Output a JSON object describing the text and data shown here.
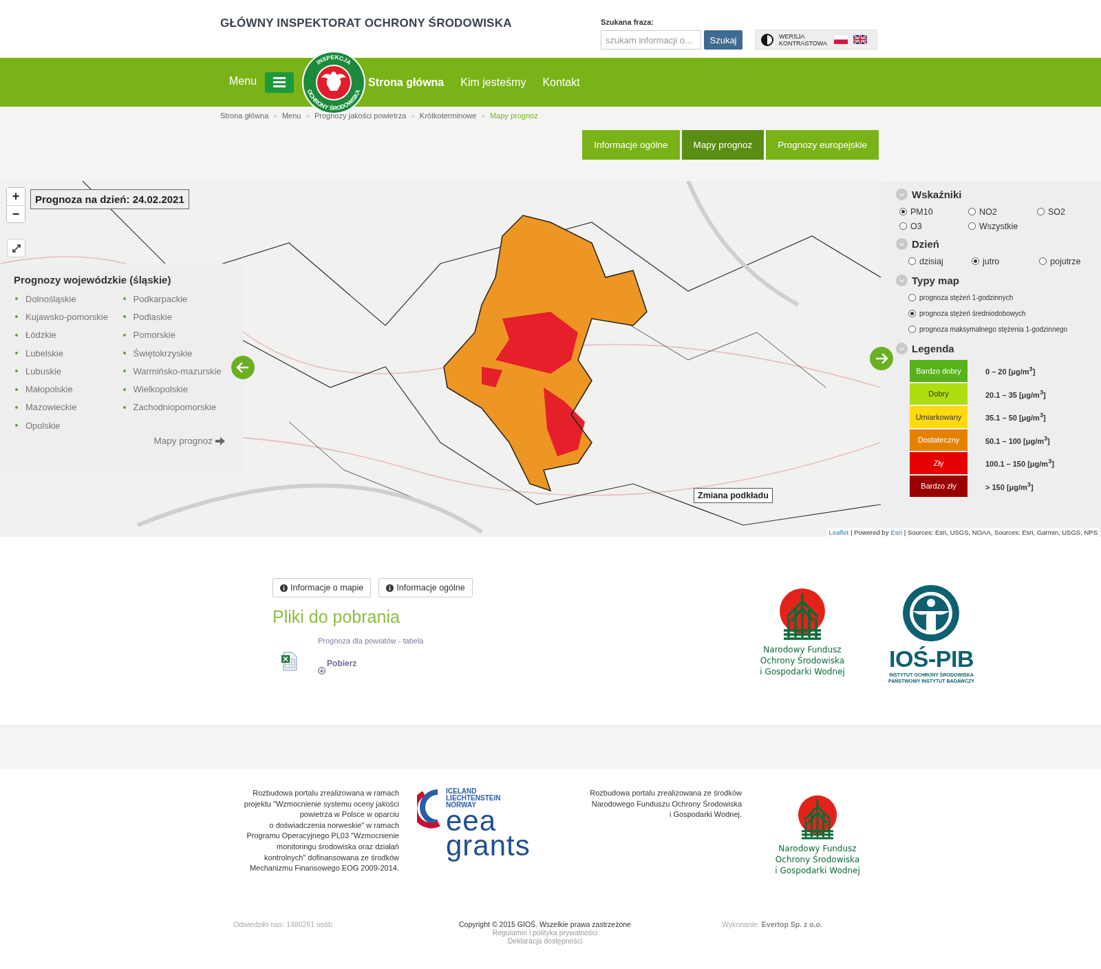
{
  "header": {
    "title": "GŁÓWNY INSPEKTORAT OCHRONY ŚRODOWISKA",
    "search_label": "Szukana fraza:",
    "search": {
      "placeholder": "szukam informacji o..."
    },
    "search_button": "Szukaj",
    "contrast_label": "WERSJA KONTRASTOWA"
  },
  "nav": {
    "menu_label": "Menu",
    "logo_top": "INSPEKCJA",
    "logo_bottom": "OCHRONY ŚRODOWISKA",
    "items": [
      {
        "label": "Strona główna",
        "selected": true
      },
      {
        "label": "Kim jesteśmy",
        "selected": false
      },
      {
        "label": "Kontakt",
        "selected": false
      }
    ]
  },
  "breadcrumb": {
    "separator": "»",
    "items": [
      {
        "label": "Strona główna",
        "current": false
      },
      {
        "label": "Menu",
        "current": false
      },
      {
        "label": "Prognozy jakości powietrza",
        "current": false
      },
      {
        "label": "Krótkoterminowe",
        "current": false
      },
      {
        "label": "Mapy prognoz",
        "current": true
      }
    ]
  },
  "tabs": [
    {
      "label": "Informacje ogólne",
      "selected": false
    },
    {
      "label": "Mapy prognoz",
      "selected": true
    },
    {
      "label": "Prognozy europejskie",
      "selected": false
    }
  ],
  "map": {
    "zoom_in": "+",
    "zoom_out": "−",
    "forecast_label": "Prognoza na dzień: 24.02.2021",
    "basemap_button": "Zmiana podkładu",
    "attribution": [
      {
        "text": "Leaflet",
        "link": true
      },
      {
        "text": "| Powered by",
        "link": false
      },
      {
        "text": "Esri",
        "link": true
      },
      {
        "text": "| Sources: Esri, USGS, NOAA, Sources: Esri, Garmin, USGS, NPS",
        "link": false
      }
    ]
  },
  "voivodeship_panel": {
    "title": "Prognozy wojewódzkie (śląskie)",
    "items": [
      "Dolnośląskie",
      "Kujawsko-pomorskie",
      "Łódzkie",
      "Lubelskie",
      "Lubuskie",
      "Małopolskie",
      "Mazowieckie",
      "Opolskie",
      "Podkarpackie",
      "Podlaskie",
      "Pomorskie",
      "Świętokrzyskie",
      "Warmińsko-mazurskie",
      "Wielkopolskie",
      "Zachodniopomorskie"
    ],
    "more_link": "Mapy prognoz"
  },
  "controls": [
    {
      "title": "Wskaźniki",
      "kind": "grid",
      "options": [
        {
          "label": "PM10",
          "selected": true
        },
        {
          "label": "NO2",
          "selected": false
        },
        {
          "label": "SO2",
          "selected": false
        },
        {
          "label": "O3",
          "selected": false
        },
        {
          "label": "Wszystkie",
          "selected": false
        }
      ]
    },
    {
      "title": "Dzień",
      "kind": "row",
      "options": [
        {
          "label": "dzisiaj",
          "selected": false
        },
        {
          "label": "jutro",
          "selected": true
        },
        {
          "label": "pojutrze",
          "selected": false
        }
      ]
    },
    {
      "title": "Typy map",
      "kind": "list",
      "options": [
        {
          "label": "prognoza stężeń 1-godzinnych",
          "selected": false
        },
        {
          "label": "prognoza stężeń średniodobowych",
          "selected": true
        },
        {
          "label": "prognoza maksymalnego stężenia 1-godzinnego",
          "selected": false
        }
      ]
    },
    {
      "title": "Legenda",
      "kind": "legend",
      "items": [
        {
          "label": "Bardzo dobry",
          "range": "0 – 20 [μg/m$^{3}$]",
          "color": "#57b21c"
        },
        {
          "label": "Dobry",
          "range": "20.1 – 35 [μg/m$^{3}$]",
          "color": "#b0dd10"
        },
        {
          "label": "Umiarkowany",
          "range": "35.1 – 50 [μg/m$^{3}$]",
          "color": "#ffd911"
        },
        {
          "label": "Dostateczny",
          "range": "50.1 – 100 [μg/m$^{3}$]",
          "color": "#e58100"
        },
        {
          "label": "Zły",
          "range": "100.1 – 150 [μg/m$^{3}$]",
          "color": "#e50000"
        },
        {
          "label": "Bardzo zły",
          "range": "> 150 [μg/m$^{3}$]",
          "color": "#990000"
        }
      ]
    }
  ],
  "content": {
    "info_buttons": [
      "Informacje o mapie",
      "Informacje ogólne"
    ],
    "downloads_title": "Pliki do pobrania",
    "file": {
      "title": "Prognoza dla powiatów - tabela",
      "download": "Pobierz"
    },
    "logos": [
      {
        "kind": "nfos",
        "lines": [
          "Narodowy Fundusz",
          "Ochrony Środowiska",
          "i Gospodarki Wodnej"
        ]
      },
      {
        "kind": "ios",
        "name": "IOŚ-PIB",
        "lines": [
          "INSTYTUT OCHRONY ŚRODOWISKA",
          "PAŃSTWOWY INSTYTUT BADAWCZY"
        ]
      }
    ]
  },
  "footer": {
    "eea_text": [
      "Rozbudowa portalu zrealizowana w ramach",
      "projektu \"Wzmocnienie systemu oceny jakości",
      "powietrza w Polsce w oparciu",
      "o doświadczenia norweskie\" w ramach",
      "Programu Operacyjnego PL03 \"Wzmocnienie",
      "monitoringu środowiska oraz działań",
      "kontrolnych\" dofinansowana ze środków",
      "Mechanizmu Finansowego EOG 2009-2014."
    ],
    "eea_logo": {
      "countries": [
        "ICELAND",
        "LIECHTENSTEIN",
        "NORWAY"
      ],
      "words": [
        "eea",
        "grants"
      ]
    },
    "nfos_text": [
      "Rozbudowa portalu zrealizowana ze środków",
      "Narodowego Funduszu Ochrony Środowiska",
      "i Gospodarki Wodnej."
    ],
    "nfos_logo": [
      "Narodowy Fundusz",
      "Ochrony Środowiska",
      "i Gospodarki Wodnej"
    ],
    "visits": "Odwiedziło nas: 1480261 osób",
    "copyright": "Copyright © 2015 GIOŚ. Wszelkie prawa zastrzeżone",
    "links": [
      "Regulamin i polityka prywatności",
      "Deklaracja dostępności"
    ],
    "credit_label": "Wykonanie:",
    "credit_name": "Evertop Sp. z o.o."
  }
}
